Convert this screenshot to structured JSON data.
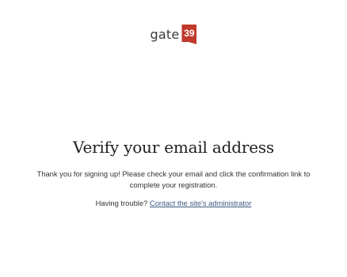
{
  "logo": {
    "word": "gate",
    "badge": "39",
    "brand_color": "#c0392b"
  },
  "main": {
    "title": "Verify your email address",
    "message": "Thank you for signing up! Please check your email and click the confirmation link to complete your registration.",
    "trouble_prefix": "Having trouble?",
    "contact_link": "Contact the site's administrator",
    "link_color": "#3d5a80"
  }
}
